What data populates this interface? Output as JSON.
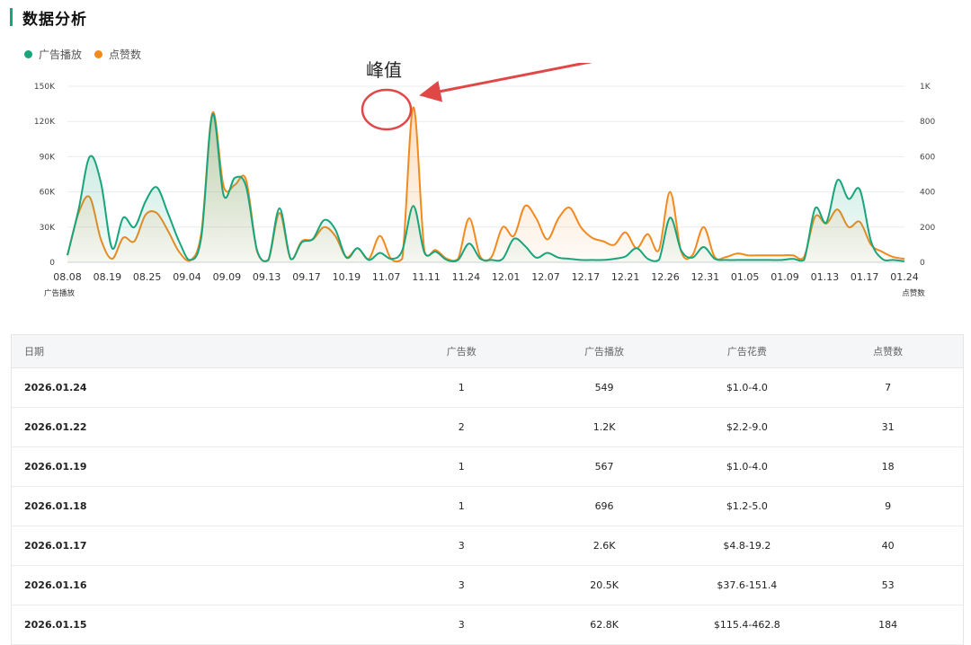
{
  "header": {
    "title": "数据分析"
  },
  "legend": [
    {
      "label": "广告播放",
      "color": "#18a57c"
    },
    {
      "label": "点赞数",
      "color": "#f28a1f"
    }
  ],
  "annotation": {
    "label": "峰值",
    "color": "#e04848"
  },
  "chart_data": {
    "type": "area",
    "x_ticks": [
      "08.08",
      "08.19",
      "08.25",
      "09.04",
      "09.09",
      "09.13",
      "09.17",
      "10.19",
      "11.07",
      "11.11",
      "11.24",
      "12.01",
      "12.07",
      "12.17",
      "12.21",
      "12.26",
      "12.31",
      "01.05",
      "01.09",
      "01.13",
      "01.17",
      "01.24"
    ],
    "y_left": {
      "label": "广告播放",
      "ticks": [
        "0",
        "30K",
        "60K",
        "90K",
        "120K",
        "150K"
      ],
      "range": [
        0,
        150000
      ]
    },
    "y_right": {
      "label": "点赞数",
      "ticks": [
        "0",
        "200",
        "400",
        "600",
        "800",
        "1K"
      ],
      "range": [
        0,
        1000
      ]
    },
    "series": [
      {
        "name": "广告播放",
        "axis": "left",
        "color": "#18a57c",
        "values": [
          6000,
          45000,
          90000,
          68000,
          12000,
          38000,
          30000,
          52000,
          64000,
          42000,
          18000,
          2000,
          22000,
          126000,
          57000,
          72000,
          65000,
          10000,
          2000,
          46000,
          3000,
          17000,
          20000,
          36000,
          28000,
          4000,
          12000,
          2000,
          8000,
          3000,
          10000,
          48000,
          8000,
          9000,
          2000,
          2000,
          16000,
          3000,
          2000,
          3000,
          20000,
          14000,
          4000,
          8000,
          4000,
          3000,
          2000,
          2000,
          2000,
          3000,
          5000,
          12000,
          3000,
          2000,
          38000,
          10000,
          4000,
          13000,
          3000,
          2000,
          2000,
          2000,
          2000,
          2000,
          2000,
          3000,
          2000,
          46000,
          34000,
          70000,
          54000,
          62000,
          18000,
          3000,
          2000,
          1000
        ]
      },
      {
        "name": "点赞数",
        "axis": "right",
        "color": "#f28a1f",
        "values": [
          40,
          280,
          370,
          130,
          20,
          140,
          120,
          270,
          280,
          180,
          60,
          10,
          170,
          850,
          430,
          440,
          470,
          60,
          10,
          280,
          20,
          120,
          130,
          200,
          150,
          30,
          80,
          20,
          150,
          20,
          20,
          880,
          60,
          70,
          20,
          20,
          250,
          30,
          30,
          200,
          150,
          320,
          250,
          130,
          250,
          310,
          200,
          140,
          120,
          100,
          170,
          80,
          160,
          70,
          400,
          60,
          40,
          200,
          30,
          30,
          50,
          40,
          40,
          40,
          40,
          40,
          30,
          260,
          220,
          300,
          200,
          230,
          100,
          60,
          30,
          20
        ]
      }
    ]
  },
  "table": {
    "headers": [
      "日期",
      "广告数",
      "广告播放",
      "广告花费",
      "点赞数"
    ],
    "rows": [
      [
        "2026.01.24",
        "1",
        "549",
        "$1.0-4.0",
        "7"
      ],
      [
        "2026.01.22",
        "2",
        "1.2K",
        "$2.2-9.0",
        "31"
      ],
      [
        "2026.01.19",
        "1",
        "567",
        "$1.0-4.0",
        "18"
      ],
      [
        "2026.01.18",
        "1",
        "696",
        "$1.2-5.0",
        "9"
      ],
      [
        "2026.01.17",
        "3",
        "2.6K",
        "$4.8-19.2",
        "40"
      ],
      [
        "2026.01.16",
        "3",
        "20.5K",
        "$37.6-151.4",
        "53"
      ],
      [
        "2026.01.15",
        "3",
        "62.8K",
        "$115.4-462.8",
        "184"
      ]
    ]
  }
}
